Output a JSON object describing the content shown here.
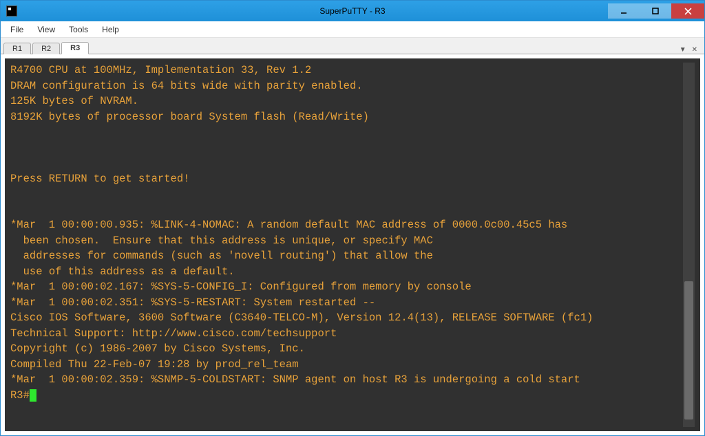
{
  "window": {
    "title": "SuperPuTTY - R3"
  },
  "menu": {
    "items": [
      "File",
      "View",
      "Tools",
      "Help"
    ]
  },
  "tabs": {
    "items": [
      {
        "label": "R1",
        "active": false
      },
      {
        "label": "R2",
        "active": false
      },
      {
        "label": "R3",
        "active": true
      }
    ]
  },
  "terminal": {
    "lines": [
      "R4700 CPU at 100MHz, Implementation 33, Rev 1.2",
      "DRAM configuration is 64 bits wide with parity enabled.",
      "125K bytes of NVRAM.",
      "8192K bytes of processor board System flash (Read/Write)",
      "",
      "",
      "",
      "Press RETURN to get started!",
      "",
      "",
      "*Mar  1 00:00:00.935: %LINK-4-NOMAC: A random default MAC address of 0000.0c00.45c5 has",
      "  been chosen.  Ensure that this address is unique, or specify MAC",
      "  addresses for commands (such as 'novell routing') that allow the",
      "  use of this address as a default.",
      "*Mar  1 00:00:02.167: %SYS-5-CONFIG_I: Configured from memory by console",
      "*Mar  1 00:00:02.351: %SYS-5-RESTART: System restarted --",
      "Cisco IOS Software, 3600 Software (C3640-TELCO-M), Version 12.4(13), RELEASE SOFTWARE (fc1)",
      "Technical Support: http://www.cisco.com/techsupport",
      "Copyright (c) 1986-2007 by Cisco Systems, Inc.",
      "Compiled Thu 22-Feb-07 19:28 by prod_rel_team",
      "*Mar  1 00:00:02.359: %SNMP-5-COLDSTART: SNMP agent on host R3 is undergoing a cold start"
    ],
    "prompt": "R3#"
  }
}
